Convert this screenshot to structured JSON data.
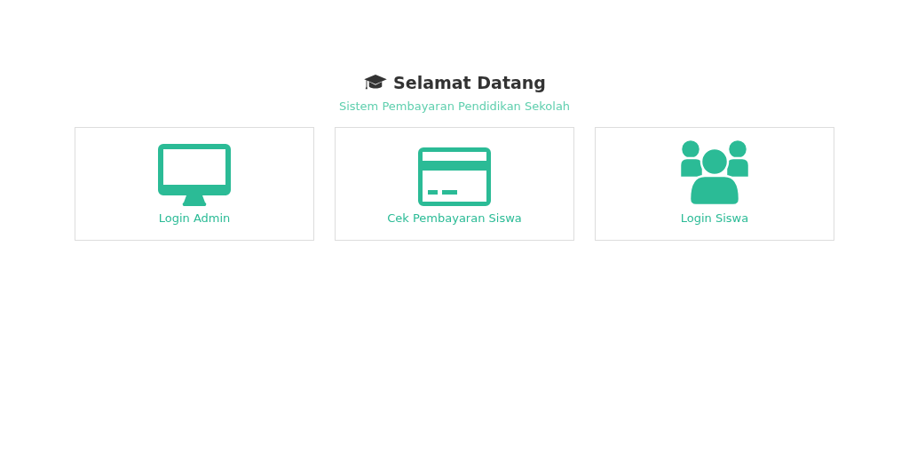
{
  "header": {
    "title": "Selamat Datang",
    "subtitle": "Sistem Pembayaran Pendidikan Sekolah"
  },
  "cards": [
    {
      "label": "Login Admin"
    },
    {
      "label": "Cek Pembayaran Siswa"
    },
    {
      "label": "Login Siswa"
    }
  ]
}
